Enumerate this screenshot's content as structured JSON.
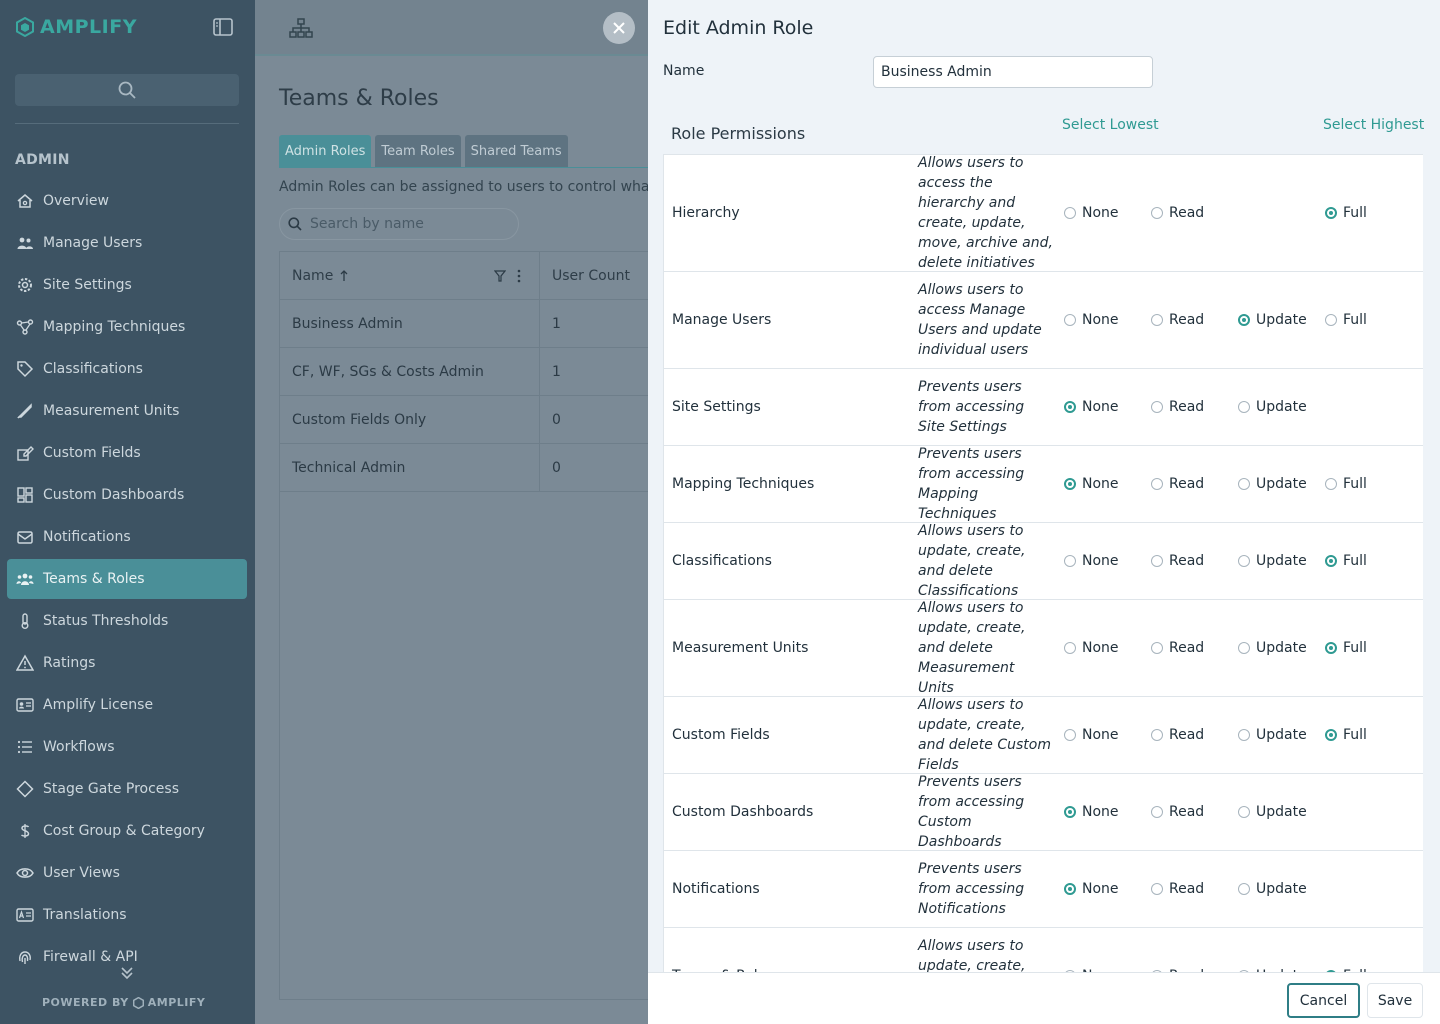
{
  "brand": {
    "name": "AMPLIFY",
    "powered_by": "POWERED BY",
    "accent": "#3aa8a0"
  },
  "sidebar": {
    "section": "ADMIN",
    "items": [
      {
        "label": "Overview",
        "icon": "home-icon"
      },
      {
        "label": "Manage Users",
        "icon": "users-icon"
      },
      {
        "label": "Site Settings",
        "icon": "gear-icon"
      },
      {
        "label": "Mapping Techniques",
        "icon": "mapping-icon"
      },
      {
        "label": "Classifications",
        "icon": "tag-icon"
      },
      {
        "label": "Measurement Units",
        "icon": "ruler-icon"
      },
      {
        "label": "Custom Fields",
        "icon": "edit-field-icon"
      },
      {
        "label": "Custom Dashboards",
        "icon": "dashboard-icon"
      },
      {
        "label": "Notifications",
        "icon": "envelope-icon"
      },
      {
        "label": "Teams & Roles",
        "icon": "team-icon",
        "active": true
      },
      {
        "label": "Status Thresholds",
        "icon": "thermometer-icon"
      },
      {
        "label": "Ratings",
        "icon": "warning-icon"
      },
      {
        "label": "Amplify License",
        "icon": "license-icon"
      },
      {
        "label": "Workflows",
        "icon": "list-icon"
      },
      {
        "label": "Stage Gate Process",
        "icon": "diamond-icon"
      },
      {
        "label": "Cost Group & Category",
        "icon": "dollar-icon"
      },
      {
        "label": "User Views",
        "icon": "eye-icon"
      },
      {
        "label": "Translations",
        "icon": "translate-icon"
      },
      {
        "label": "Firewall & API",
        "icon": "fingerprint-icon"
      }
    ]
  },
  "main": {
    "title": "Teams & Roles",
    "tabs": [
      "Admin Roles",
      "Team Roles",
      "Shared Teams"
    ],
    "help": "Admin Roles can be assigned to users to control what they can access",
    "search_placeholder": "Search by name",
    "columns": [
      "Name",
      "User Count"
    ],
    "rows": [
      {
        "name": "Business Admin",
        "count": "1"
      },
      {
        "name": "CF, WF, SGs & Costs Admin",
        "count": "1"
      },
      {
        "name": "Custom Fields Only",
        "count": "0"
      },
      {
        "name": "Technical Admin",
        "count": "0"
      }
    ]
  },
  "drawer": {
    "title": "Edit Admin Role",
    "name_label": "Name",
    "name_value": "Business Admin",
    "permissions_title": "Role Permissions",
    "select_lowest": "Select Lowest",
    "select_highest": "Select Highest",
    "option_labels": {
      "none": "None",
      "read": "Read",
      "update": "Update",
      "full": "Full"
    },
    "permissions": [
      {
        "name": "Hierarchy",
        "desc": "Allows users to access the hierarchy and create, update, move, archive and, delete initiatives",
        "options": [
          "none",
          "read",
          "full"
        ],
        "selected": "full",
        "height": 117
      },
      {
        "name": "Manage Users",
        "desc": "Allows users to access Manage Users and update individual users",
        "options": [
          "none",
          "read",
          "update",
          "full"
        ],
        "selected": "update",
        "height": 97
      },
      {
        "name": "Site Settings",
        "desc": "Prevents users from accessing Site Settings",
        "options": [
          "none",
          "read",
          "update"
        ],
        "selected": "none",
        "height": 77
      },
      {
        "name": "Mapping Techniques",
        "desc": "Prevents users from accessing Mapping Techniques",
        "options": [
          "none",
          "read",
          "update",
          "full"
        ],
        "selected": "none",
        "height": 77
      },
      {
        "name": "Classifications",
        "desc": "Allows users to update, create, and delete Classifications",
        "options": [
          "none",
          "read",
          "update",
          "full"
        ],
        "selected": "full",
        "height": 77
      },
      {
        "name": "Measurement Units",
        "desc": "Allows users to update, create, and delete Measurement Units",
        "options": [
          "none",
          "read",
          "update",
          "full"
        ],
        "selected": "full",
        "height": 97
      },
      {
        "name": "Custom Fields",
        "desc": "Allows users to update, create, and delete Custom Fields",
        "options": [
          "none",
          "read",
          "update",
          "full"
        ],
        "selected": "full",
        "height": 77
      },
      {
        "name": "Custom Dashboards",
        "desc": "Prevents users from accessing Custom Dashboards",
        "options": [
          "none",
          "read",
          "update"
        ],
        "selected": "none",
        "height": 77
      },
      {
        "name": "Notifications",
        "desc": "Prevents users from accessing Notifications",
        "options": [
          "none",
          "read",
          "update"
        ],
        "selected": "none",
        "height": 77
      },
      {
        "name": "Teams & Roles",
        "desc": "Allows users to update, create, and delete Teams & Roles",
        "options": [
          "none",
          "read",
          "update",
          "full"
        ],
        "selected": "full",
        "height": 97
      }
    ],
    "cancel_label": "Cancel",
    "save_label": "Save"
  }
}
